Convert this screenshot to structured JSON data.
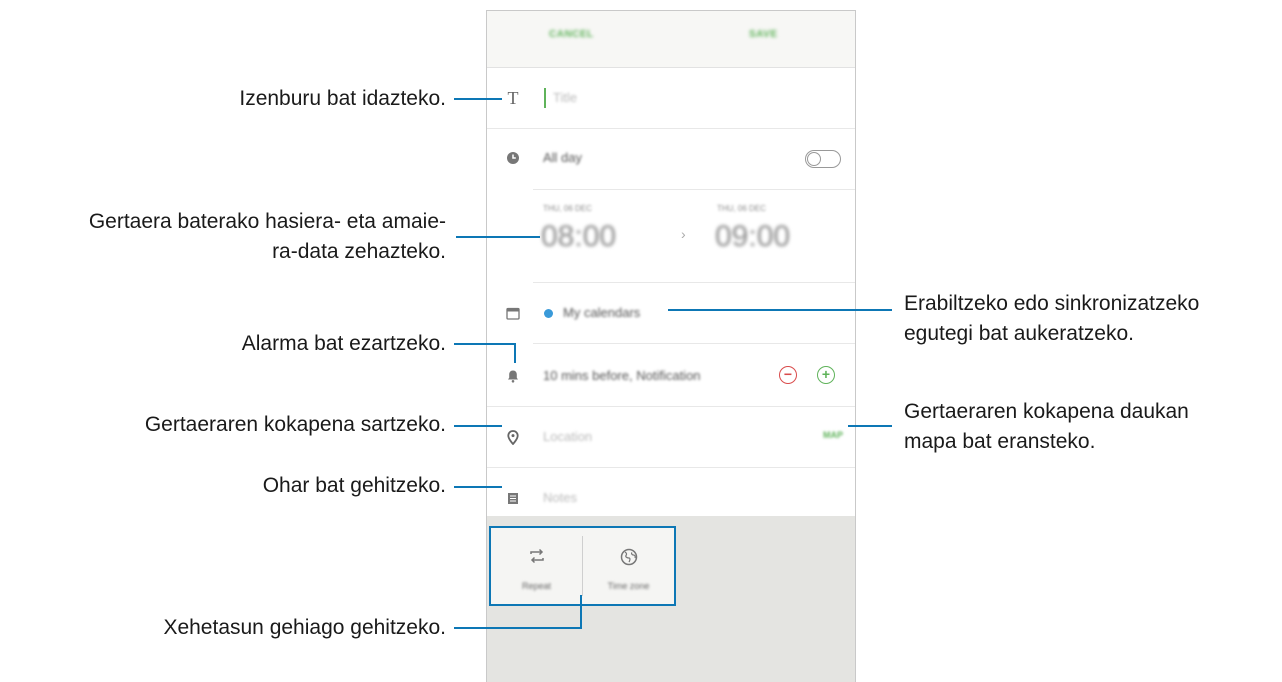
{
  "app": {
    "header": {
      "cancel_label": "CANCEL",
      "save_label": "SAVE"
    },
    "form": {
      "title_placeholder": "Title",
      "all_day_label": "All day",
      "all_day_on": false,
      "start": {
        "date": "THU, 06 DEC",
        "time": "08:00"
      },
      "end": {
        "date": "THU, 06 DEC",
        "time": "09:00"
      },
      "calendar_label": "My calendars",
      "reminder_label": "10 mins before, Notification",
      "location_placeholder": "Location",
      "map_label": "MAP",
      "notes_placeholder": "Notes"
    },
    "options": [
      {
        "label": "Repeat",
        "icon": "repeat-icon"
      },
      {
        "label": "Time zone",
        "icon": "globe-icon"
      }
    ],
    "colors": {
      "accent": "#5fb35a",
      "callout": "#0d77b5",
      "calendar_dot": "#3a9ad9"
    }
  },
  "annotations": {
    "title": "Izenburu bat idazteko.",
    "date_line1": "Gertaera baterako hasiera- eta amaie-",
    "date_line2": "ra-data zehazteko.",
    "alarm": "Alarma bat ezartzeko.",
    "location": "Gertaeraren kokapena sartzeko.",
    "note": "Ohar bat gehitzeko.",
    "more": "Xehetasun gehiago gehitzeko.",
    "calendar_line1": "Erabiltzeko edo sinkronizatzeko",
    "calendar_line2": "egutegi bat aukeratzeko.",
    "map_line1": "Gertaeraren kokapena daukan",
    "map_line2": "mapa bat eransteko."
  }
}
